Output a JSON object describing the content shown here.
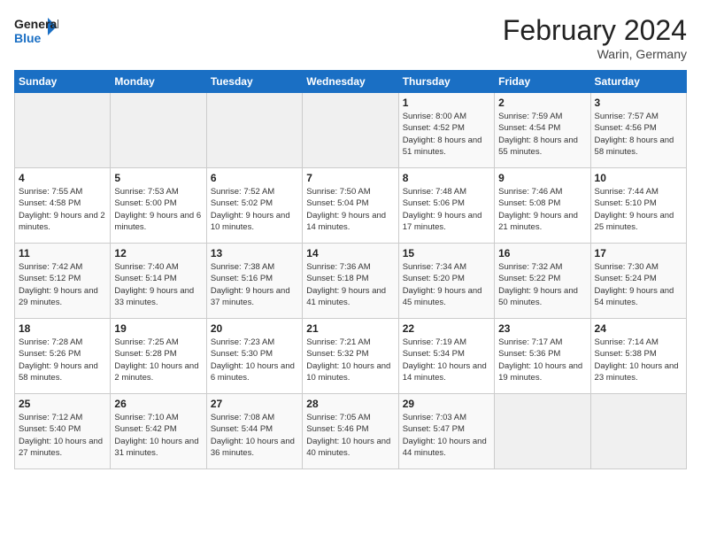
{
  "header": {
    "logo_general": "General",
    "logo_blue": "Blue",
    "month_title": "February 2024",
    "location": "Warin, Germany"
  },
  "weekdays": [
    "Sunday",
    "Monday",
    "Tuesday",
    "Wednesday",
    "Thursday",
    "Friday",
    "Saturday"
  ],
  "weeks": [
    [
      {
        "day": "",
        "sunrise": "",
        "sunset": "",
        "daylight": ""
      },
      {
        "day": "",
        "sunrise": "",
        "sunset": "",
        "daylight": ""
      },
      {
        "day": "",
        "sunrise": "",
        "sunset": "",
        "daylight": ""
      },
      {
        "day": "",
        "sunrise": "",
        "sunset": "",
        "daylight": ""
      },
      {
        "day": "1",
        "sunrise": "Sunrise: 8:00 AM",
        "sunset": "Sunset: 4:52 PM",
        "daylight": "Daylight: 8 hours and 51 minutes."
      },
      {
        "day": "2",
        "sunrise": "Sunrise: 7:59 AM",
        "sunset": "Sunset: 4:54 PM",
        "daylight": "Daylight: 8 hours and 55 minutes."
      },
      {
        "day": "3",
        "sunrise": "Sunrise: 7:57 AM",
        "sunset": "Sunset: 4:56 PM",
        "daylight": "Daylight: 8 hours and 58 minutes."
      }
    ],
    [
      {
        "day": "4",
        "sunrise": "Sunrise: 7:55 AM",
        "sunset": "Sunset: 4:58 PM",
        "daylight": "Daylight: 9 hours and 2 minutes."
      },
      {
        "day": "5",
        "sunrise": "Sunrise: 7:53 AM",
        "sunset": "Sunset: 5:00 PM",
        "daylight": "Daylight: 9 hours and 6 minutes."
      },
      {
        "day": "6",
        "sunrise": "Sunrise: 7:52 AM",
        "sunset": "Sunset: 5:02 PM",
        "daylight": "Daylight: 9 hours and 10 minutes."
      },
      {
        "day": "7",
        "sunrise": "Sunrise: 7:50 AM",
        "sunset": "Sunset: 5:04 PM",
        "daylight": "Daylight: 9 hours and 14 minutes."
      },
      {
        "day": "8",
        "sunrise": "Sunrise: 7:48 AM",
        "sunset": "Sunset: 5:06 PM",
        "daylight": "Daylight: 9 hours and 17 minutes."
      },
      {
        "day": "9",
        "sunrise": "Sunrise: 7:46 AM",
        "sunset": "Sunset: 5:08 PM",
        "daylight": "Daylight: 9 hours and 21 minutes."
      },
      {
        "day": "10",
        "sunrise": "Sunrise: 7:44 AM",
        "sunset": "Sunset: 5:10 PM",
        "daylight": "Daylight: 9 hours and 25 minutes."
      }
    ],
    [
      {
        "day": "11",
        "sunrise": "Sunrise: 7:42 AM",
        "sunset": "Sunset: 5:12 PM",
        "daylight": "Daylight: 9 hours and 29 minutes."
      },
      {
        "day": "12",
        "sunrise": "Sunrise: 7:40 AM",
        "sunset": "Sunset: 5:14 PM",
        "daylight": "Daylight: 9 hours and 33 minutes."
      },
      {
        "day": "13",
        "sunrise": "Sunrise: 7:38 AM",
        "sunset": "Sunset: 5:16 PM",
        "daylight": "Daylight: 9 hours and 37 minutes."
      },
      {
        "day": "14",
        "sunrise": "Sunrise: 7:36 AM",
        "sunset": "Sunset: 5:18 PM",
        "daylight": "Daylight: 9 hours and 41 minutes."
      },
      {
        "day": "15",
        "sunrise": "Sunrise: 7:34 AM",
        "sunset": "Sunset: 5:20 PM",
        "daylight": "Daylight: 9 hours and 45 minutes."
      },
      {
        "day": "16",
        "sunrise": "Sunrise: 7:32 AM",
        "sunset": "Sunset: 5:22 PM",
        "daylight": "Daylight: 9 hours and 50 minutes."
      },
      {
        "day": "17",
        "sunrise": "Sunrise: 7:30 AM",
        "sunset": "Sunset: 5:24 PM",
        "daylight": "Daylight: 9 hours and 54 minutes."
      }
    ],
    [
      {
        "day": "18",
        "sunrise": "Sunrise: 7:28 AM",
        "sunset": "Sunset: 5:26 PM",
        "daylight": "Daylight: 9 hours and 58 minutes."
      },
      {
        "day": "19",
        "sunrise": "Sunrise: 7:25 AM",
        "sunset": "Sunset: 5:28 PM",
        "daylight": "Daylight: 10 hours and 2 minutes."
      },
      {
        "day": "20",
        "sunrise": "Sunrise: 7:23 AM",
        "sunset": "Sunset: 5:30 PM",
        "daylight": "Daylight: 10 hours and 6 minutes."
      },
      {
        "day": "21",
        "sunrise": "Sunrise: 7:21 AM",
        "sunset": "Sunset: 5:32 PM",
        "daylight": "Daylight: 10 hours and 10 minutes."
      },
      {
        "day": "22",
        "sunrise": "Sunrise: 7:19 AM",
        "sunset": "Sunset: 5:34 PM",
        "daylight": "Daylight: 10 hours and 14 minutes."
      },
      {
        "day": "23",
        "sunrise": "Sunrise: 7:17 AM",
        "sunset": "Sunset: 5:36 PM",
        "daylight": "Daylight: 10 hours and 19 minutes."
      },
      {
        "day": "24",
        "sunrise": "Sunrise: 7:14 AM",
        "sunset": "Sunset: 5:38 PM",
        "daylight": "Daylight: 10 hours and 23 minutes."
      }
    ],
    [
      {
        "day": "25",
        "sunrise": "Sunrise: 7:12 AM",
        "sunset": "Sunset: 5:40 PM",
        "daylight": "Daylight: 10 hours and 27 minutes."
      },
      {
        "day": "26",
        "sunrise": "Sunrise: 7:10 AM",
        "sunset": "Sunset: 5:42 PM",
        "daylight": "Daylight: 10 hours and 31 minutes."
      },
      {
        "day": "27",
        "sunrise": "Sunrise: 7:08 AM",
        "sunset": "Sunset: 5:44 PM",
        "daylight": "Daylight: 10 hours and 36 minutes."
      },
      {
        "day": "28",
        "sunrise": "Sunrise: 7:05 AM",
        "sunset": "Sunset: 5:46 PM",
        "daylight": "Daylight: 10 hours and 40 minutes."
      },
      {
        "day": "29",
        "sunrise": "Sunrise: 7:03 AM",
        "sunset": "Sunset: 5:47 PM",
        "daylight": "Daylight: 10 hours and 44 minutes."
      },
      {
        "day": "",
        "sunrise": "",
        "sunset": "",
        "daylight": ""
      },
      {
        "day": "",
        "sunrise": "",
        "sunset": "",
        "daylight": ""
      }
    ]
  ]
}
